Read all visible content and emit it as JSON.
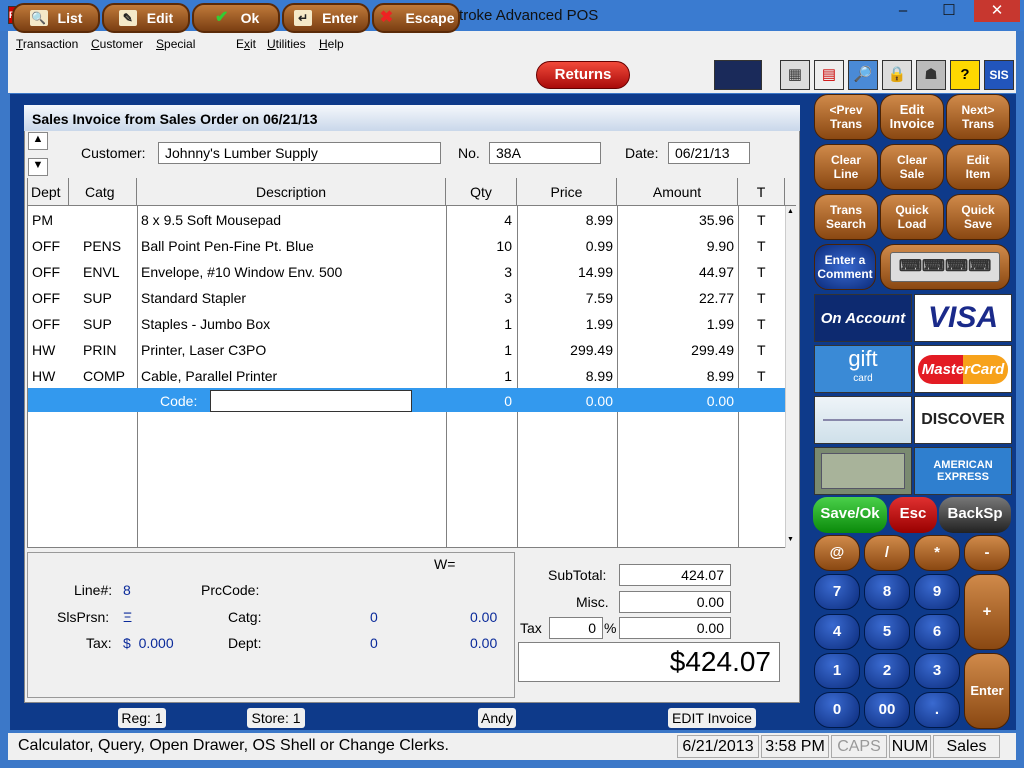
{
  "window": {
    "title": "Keystroke Advanced POS",
    "app_icon": "POS",
    "minimize": "–",
    "maximize": "☐",
    "close": "✕"
  },
  "menu": [
    {
      "label": "Transaction",
      "u": "T",
      "rest": "ransaction"
    },
    {
      "label": "Customer",
      "u": "C",
      "rest": "ustomer"
    },
    {
      "label": "Special",
      "u": "S",
      "rest": "pecial"
    },
    {
      "label": "Exit",
      "u": "x",
      "pre": "E",
      "rest": "it"
    },
    {
      "label": "Utilities",
      "u": "U",
      "rest": "tilities"
    },
    {
      "label": "Help",
      "u": "H",
      "rest": "elp"
    }
  ],
  "toolbar": {
    "list": "List",
    "edit": "Edit",
    "ok": "Ok",
    "enter": "Enter",
    "escape": "Escape",
    "returns": "Returns"
  },
  "invoice": {
    "header": "Sales Invoice from Sales Order on 06/21/13",
    "customer_label": "Customer:",
    "customer": "Johnny's Lumber Supply",
    "no_label": "No.",
    "no": "38A",
    "date_label": "Date:",
    "date": "06/21/13",
    "up_arrow": "▲",
    "down_arrow": "▼"
  },
  "columns": [
    "Dept",
    "Catg",
    "Description",
    "Qty",
    "Price",
    "Amount",
    "T"
  ],
  "rows": [
    {
      "dept": "PM",
      "catg": "",
      "desc": "8 x 9.5 Soft Mousepad",
      "qty": "4",
      "price": "8.99",
      "amount": "35.96",
      "t": "T"
    },
    {
      "dept": "OFF",
      "catg": "PENS",
      "desc": "Ball Point Pen-Fine Pt. Blue",
      "qty": "10",
      "price": "0.99",
      "amount": "9.90",
      "t": "T"
    },
    {
      "dept": "OFF",
      "catg": "ENVL",
      "desc": "Envelope, #10 Window Env. 500",
      "qty": "3",
      "price": "14.99",
      "amount": "44.97",
      "t": "T"
    },
    {
      "dept": "OFF",
      "catg": "SUP",
      "desc": "Standard Stapler",
      "qty": "3",
      "price": "7.59",
      "amount": "22.77",
      "t": "T"
    },
    {
      "dept": "OFF",
      "catg": "SUP",
      "desc": "Staples - Jumbo Box",
      "qty": "1",
      "price": "1.99",
      "amount": "1.99",
      "t": "T"
    },
    {
      "dept": "HW",
      "catg": "PRIN",
      "desc": "Printer, Laser C3PO",
      "qty": "1",
      "price": "299.49",
      "amount": "299.49",
      "t": "T"
    },
    {
      "dept": "HW",
      "catg": "COMP",
      "desc": "Cable, Parallel Printer",
      "qty": "1",
      "price": "8.99",
      "amount": "8.99",
      "t": "T"
    }
  ],
  "entry_row": {
    "code_label": "Code:",
    "code": "",
    "qty": "0",
    "price": "0.00",
    "amount": "0.00"
  },
  "footer": {
    "w_label": "W=",
    "line_label": "Line#:",
    "line": "8",
    "prccode_label": "PrcCode:",
    "slsprsn_label": "SlsPrsn:",
    "slsprsn": "Ξ",
    "catg_label": "Catg:",
    "catg_qty": "0",
    "catg_amt": "0.00",
    "tax_label": "Tax:",
    "tax_value": "$  0.000",
    "dept_label": "Dept:",
    "dept_qty": "0",
    "dept_amt": "0.00",
    "subtotal_label": "SubTotal:",
    "subtotal": "424.07",
    "misc_label": "Misc.",
    "misc": "0.00",
    "tax2_label": "Tax",
    "tax_pct": "0",
    "pct": "%",
    "tax_amt": "0.00",
    "grand_total": "$424.07"
  },
  "side": {
    "prev_trans": "<Prev\nTrans",
    "edit_invoice": "Edit\nInvoice",
    "next_trans": "Next>\nTrans",
    "clear_line": "Clear\nLine",
    "clear_sale": "Clear\nSale",
    "edit_item": "Edit\nItem",
    "trans_search": "Trans\nSearch",
    "quick_load": "Quick\nLoad",
    "quick_save": "Quick\nSave",
    "enter_comment": "Enter a\nComment",
    "on_account": "On Account",
    "visa": "VISA",
    "gift": "gift",
    "gift_sub": "card",
    "mastercard": "MasterCard",
    "discover": "DISCOVER",
    "amex": "AMERICAN\nEXPRESS",
    "save_ok": "Save/Ok",
    "esc": "Esc",
    "backsp": "BackSp"
  },
  "keypad": [
    "@",
    "/",
    "*",
    "-",
    "7",
    "8",
    "9",
    "+",
    "4",
    "5",
    "6",
    "1",
    "2",
    "3",
    "Enter",
    "0",
    "00",
    "."
  ],
  "regbar": {
    "reg": "Reg: 1",
    "store": "Store: 1",
    "clerk": "Andy",
    "mode": "EDIT Invoice"
  },
  "status": {
    "message": "Calculator, Query, Open Drawer, OS Shell or Change Clerks.",
    "date": "6/21/2013",
    "time": "3:58 PM",
    "caps": "CAPS",
    "num": "NUM",
    "mode": "Sales"
  },
  "colors": {
    "accent": "#0e3a8a",
    "selection": "#3399ee",
    "button": "#8a4812"
  }
}
